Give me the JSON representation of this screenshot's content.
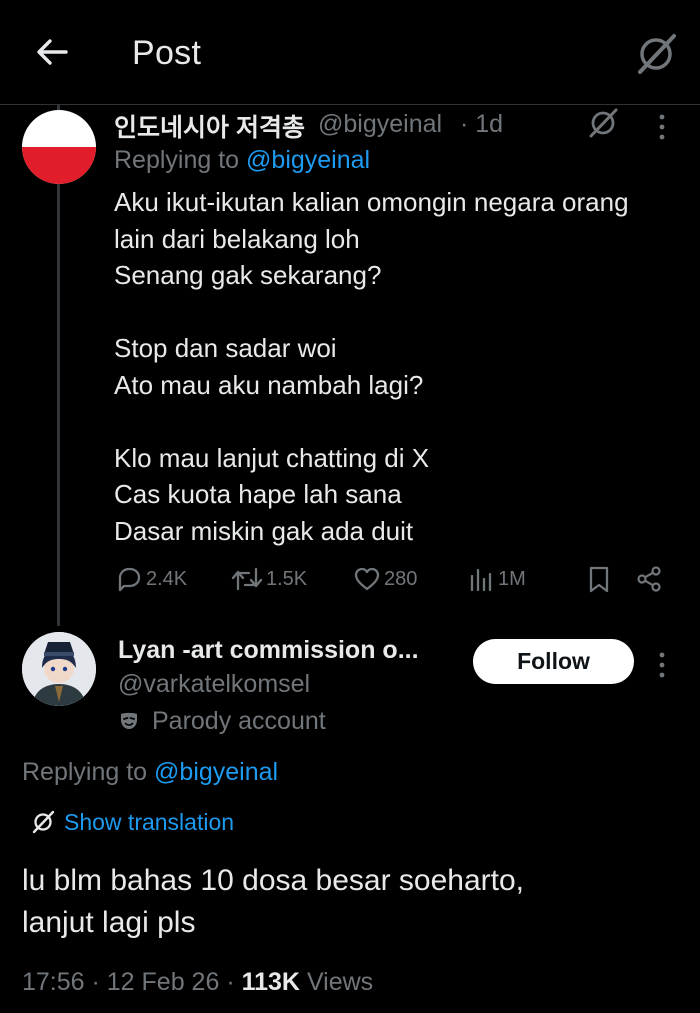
{
  "header": {
    "title": "Post",
    "back_icon": "arrow-left-icon",
    "grok_icon": "grok-icon"
  },
  "colors": {
    "background": "#000000",
    "text": "#e7e9ea",
    "muted": "#71767b",
    "link": "#1d9bf0",
    "follow_bg": "#ffffff"
  },
  "tweet": {
    "display_name": "인도네시아 저격총",
    "handle": "@bigyeinal",
    "time": "· 1d",
    "replying_label": "Replying to ",
    "replying_handle": "@bigyeinal",
    "body": "Aku ikut-ikutan kalian omongin negara orang\nlain dari belakang loh\nSenang gak sekarang?\n\nStop dan sadar woi\nAto mau aku nambah lagi?\n\nKlo mau lanjut chatting di X\nCas kuota hape lah sana\nDasar miskin gak ada duit",
    "actions": {
      "replies": "2.4K",
      "reposts": "1.5K",
      "likes": "280",
      "views": "1M"
    }
  },
  "reply": {
    "display_name": "Lyan -art commission o...",
    "handle": "@varkatelkomsel",
    "parody_label": "Parody account",
    "follow_label": "Follow",
    "replying_label": "Replying to ",
    "replying_handle": "@bigyeinal",
    "translate_label": "Show translation",
    "body": "lu blm bahas 10 dosa besar soeharto,\nlanjut lagi pls",
    "meta": {
      "time": "17:56",
      "date": "12 Feb 26",
      "views_count": "113K",
      "views_label": "Views"
    }
  }
}
